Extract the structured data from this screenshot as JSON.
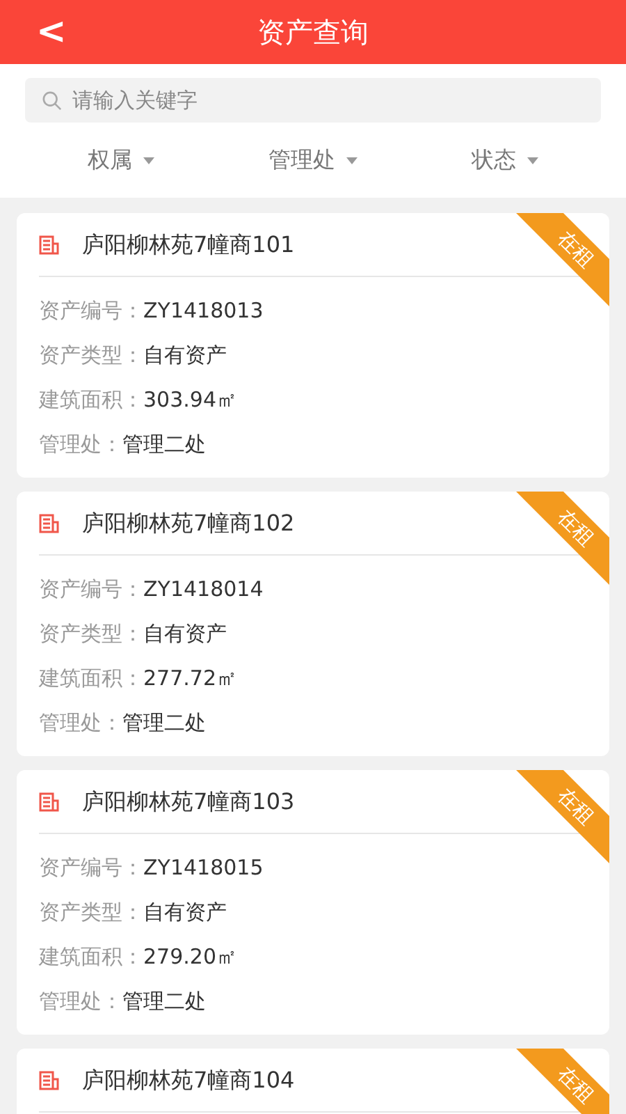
{
  "header": {
    "back": "<",
    "title": "资产查询"
  },
  "search": {
    "placeholder": "请输入关键字"
  },
  "filters": [
    {
      "label": "权属"
    },
    {
      "label": "管理处"
    },
    {
      "label": "状态"
    }
  ],
  "assets": [
    {
      "name": "庐阳柳林苑7幢商101",
      "status": "在租",
      "fields": [
        {
          "label": "资产编号：",
          "value": "ZY1418013"
        },
        {
          "label": "资产类型：",
          "value": "自有资产"
        },
        {
          "label": "建筑面积：",
          "value": "303.94㎡"
        },
        {
          "label": "管理处：",
          "value": "管理二处"
        }
      ]
    },
    {
      "name": "庐阳柳林苑7幢商102",
      "status": "在租",
      "fields": [
        {
          "label": "资产编号：",
          "value": "ZY1418014"
        },
        {
          "label": "资产类型：",
          "value": "自有资产"
        },
        {
          "label": "建筑面积：",
          "value": "277.72㎡"
        },
        {
          "label": "管理处：",
          "value": "管理二处"
        }
      ]
    },
    {
      "name": "庐阳柳林苑7幢商103",
      "status": "在租",
      "fields": [
        {
          "label": "资产编号：",
          "value": "ZY1418015"
        },
        {
          "label": "资产类型：",
          "value": "自有资产"
        },
        {
          "label": "建筑面积：",
          "value": "279.20㎡"
        },
        {
          "label": "管理处：",
          "value": "管理二处"
        }
      ]
    },
    {
      "name": "庐阳柳林苑7幢商104",
      "status": "在租"
    }
  ]
}
